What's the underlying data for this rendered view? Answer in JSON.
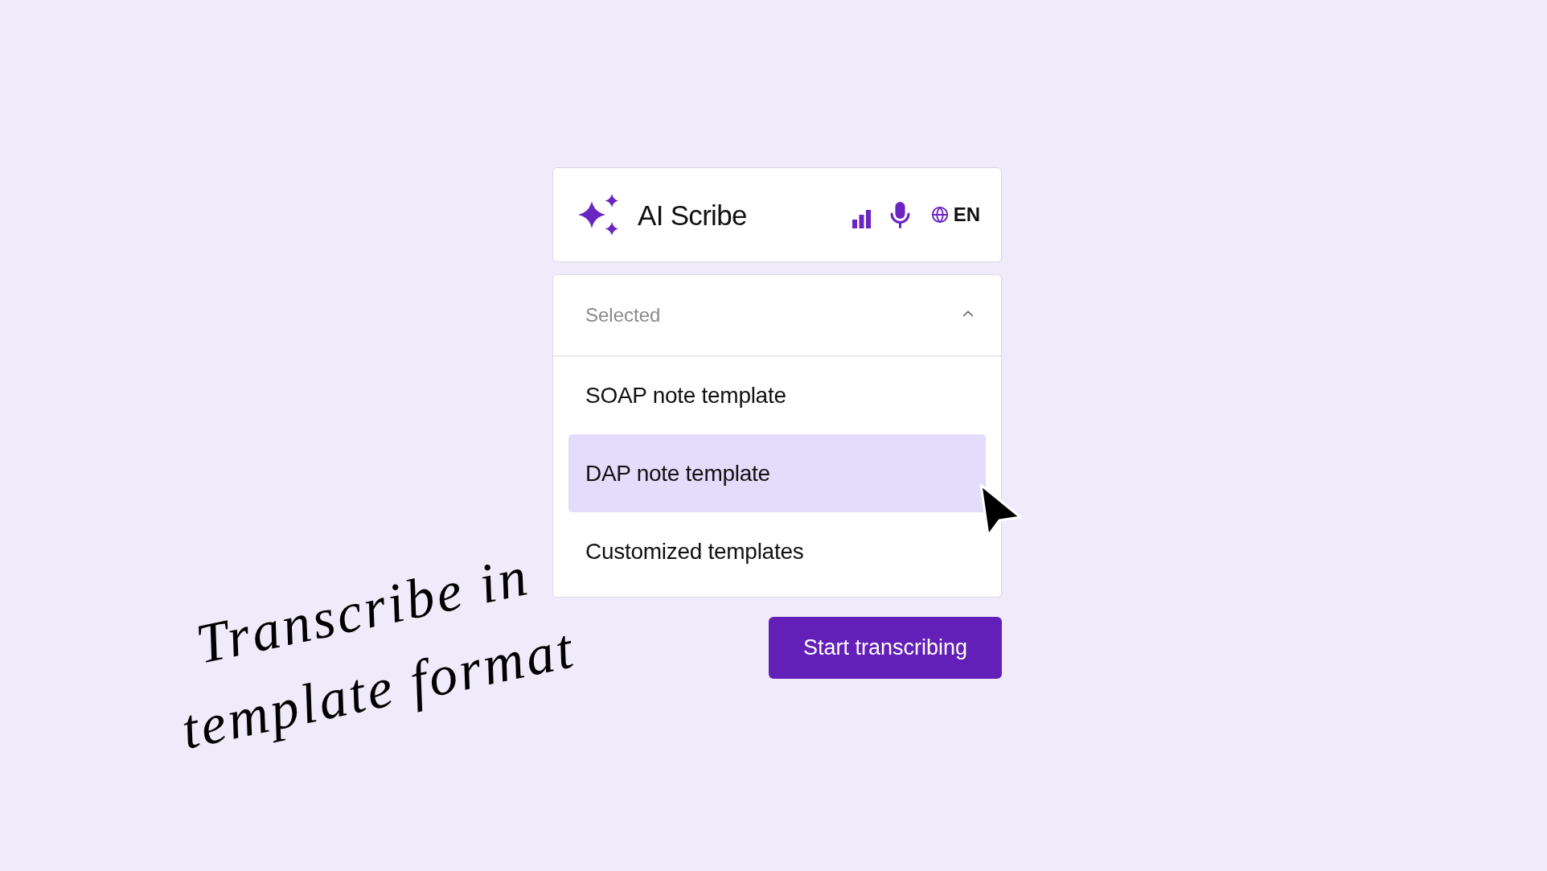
{
  "header": {
    "title": "AI Scribe",
    "language": "EN"
  },
  "dropdown": {
    "placeholder": "Selected",
    "expanded": true,
    "options": [
      {
        "label": "SOAP note template",
        "selected": false
      },
      {
        "label": "DAP note template",
        "selected": true
      },
      {
        "label": "Customized templates",
        "selected": false
      }
    ]
  },
  "primary_button": {
    "label": "Start transcribing"
  },
  "handwritten_note": {
    "lines": [
      "Transcribe in",
      "template format"
    ]
  }
}
